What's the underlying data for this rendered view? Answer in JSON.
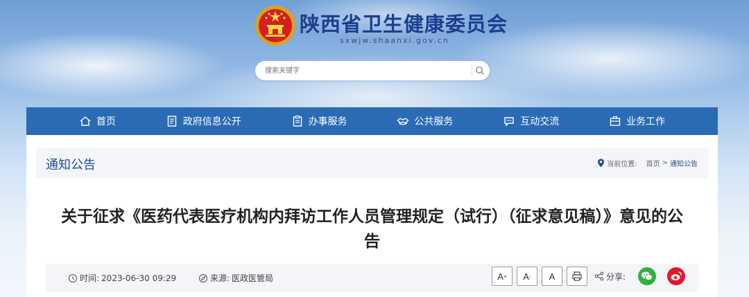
{
  "header": {
    "site_name": "陕西省卫生健康委员会",
    "domain": "sxwjw.shaanxi.gov.cn"
  },
  "search": {
    "placeholder": "搜索关键字"
  },
  "nav": {
    "items": [
      {
        "label": "首页",
        "icon": "home-icon"
      },
      {
        "label": "政府信息公开",
        "icon": "document-icon"
      },
      {
        "label": "办事服务",
        "icon": "clipboard-icon"
      },
      {
        "label": "公共服务",
        "icon": "handshake-icon"
      },
      {
        "label": "互动交流",
        "icon": "chat-icon"
      },
      {
        "label": "业务工作",
        "icon": "briefcase-icon"
      }
    ]
  },
  "breadcrumb": {
    "section": "通知公告",
    "location_label": "当前位置:",
    "home": "首页",
    "separator": ">",
    "current": "通知公告"
  },
  "article": {
    "title": "关于征求《医药代表医疗机构内拜访工作人员管理规定（试行）（征求意见稿）》意见的公告",
    "time_label": "时间:",
    "time_value": "2023-06-30 09:29",
    "source_label": "来源:",
    "source_value": "医政医管局"
  },
  "tools": {
    "font_large": "A",
    "font_small": "A",
    "font_normal": "A",
    "share_label": "分享:"
  },
  "colors": {
    "nav_bg": "#2a6bb4",
    "title_blue": "#1b3f8e",
    "wechat": "#2eb33a",
    "weibo": "#e6162d"
  }
}
